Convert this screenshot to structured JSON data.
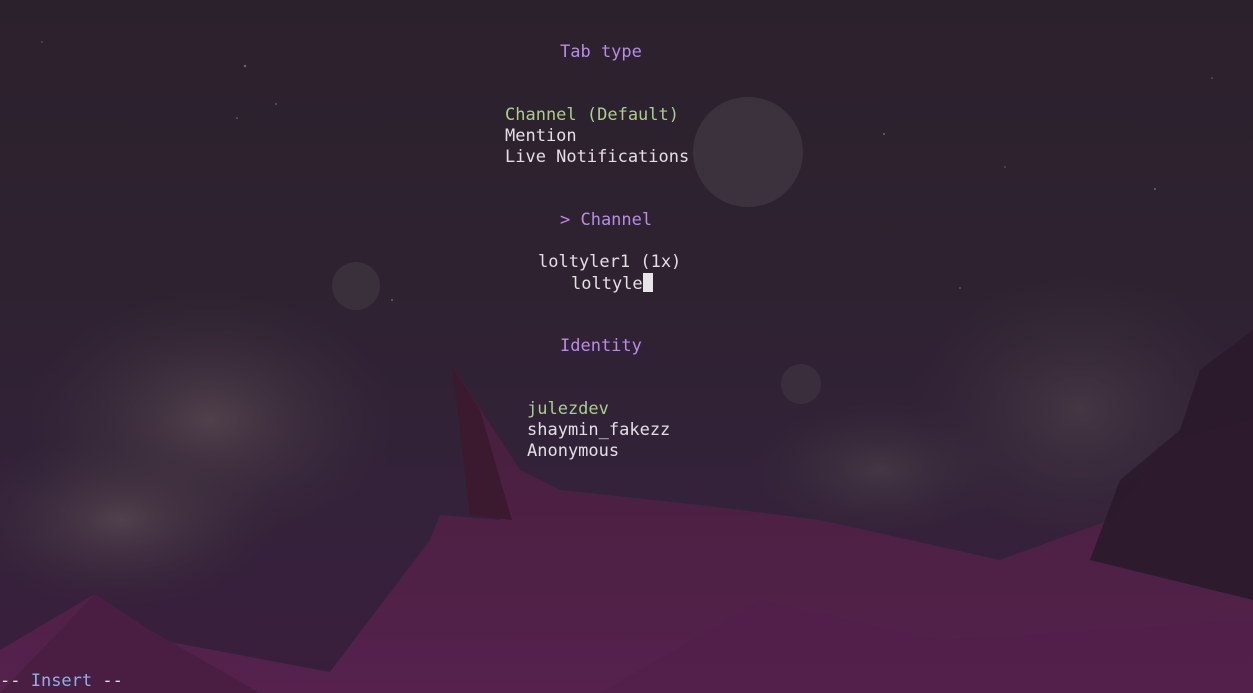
{
  "tab_type": {
    "heading": "Tab type",
    "options": [
      "Channel (Default)",
      "Mention",
      "Live Notifications"
    ],
    "selected_index": 0
  },
  "channel": {
    "heading": "> Channel",
    "suggestion": "loltyler1 (1x)",
    "input_value": "loltyle"
  },
  "identity": {
    "heading": "Identity",
    "options": [
      "julezdev",
      "shaymin_fakezz",
      "Anonymous"
    ],
    "selected_index": 0
  },
  "statusline": {
    "prefix": "-- ",
    "mode": "Insert",
    "suffix": " --"
  },
  "colors": {
    "heading": "#b98be6",
    "selected": "#a9cf8a",
    "text": "#e4dfe4",
    "mode": "#8ab4e8"
  }
}
